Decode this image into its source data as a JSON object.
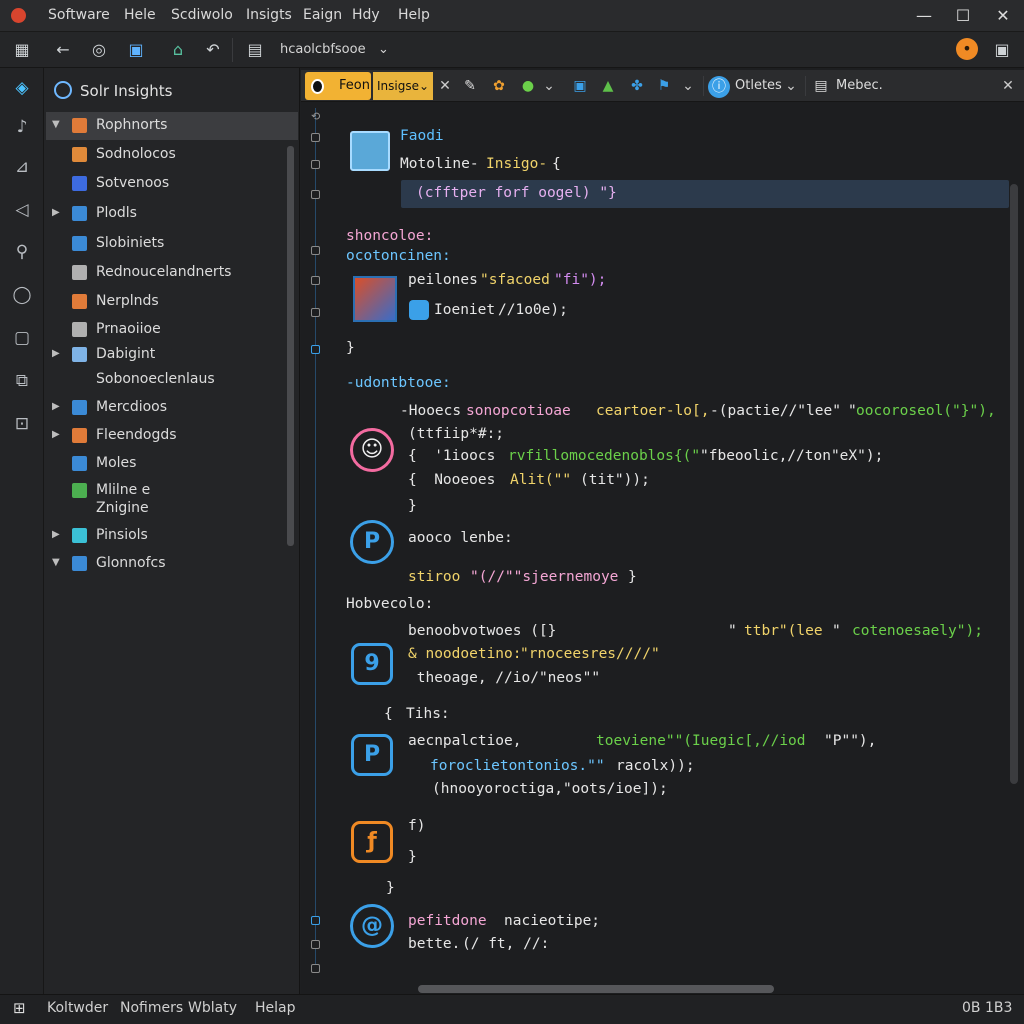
{
  "menu": [
    "Software",
    "Hele",
    "Scdiwolo",
    "Insigts",
    "Eaign",
    "Hdy",
    "Help"
  ],
  "window_controls": {
    "minimize": "—",
    "maximize": "☐",
    "close": "✕"
  },
  "toolbar": {
    "file_select": "hcaolcbfsooe"
  },
  "sidebar": {
    "title": "Solr Insights",
    "items": [
      {
        "label": "Rophnorts",
        "twisty": "▼",
        "color": "#e07b39",
        "selected": true
      },
      {
        "label": "Sodnolocos",
        "twisty": "",
        "color": "#e08a3a"
      },
      {
        "label": "Sotvenoos",
        "twisty": "",
        "color": "#3d6be0"
      },
      {
        "label": "Plodls",
        "twisty": "▶",
        "color": "#3b8ad6"
      },
      {
        "label": "Slobiniets",
        "twisty": "",
        "color": "#3b8ad6"
      },
      {
        "label": "Rednoucelandnerts",
        "twisty": "",
        "color": "#b0b0b0"
      },
      {
        "label": "Nerplnds",
        "twisty": "",
        "color": "#e07b39"
      },
      {
        "label": "Prnaoiioe",
        "twisty": "",
        "color": "#b0b0b0"
      },
      {
        "label": "Dabigint",
        "twisty": "▶",
        "color": "#7fb3e6"
      },
      {
        "label": "Sobonoeclenlaus",
        "twisty": "",
        "color": ""
      },
      {
        "label": "Mercdioos",
        "twisty": "▶",
        "color": "#3b8ad6"
      },
      {
        "label": "Fleendogds",
        "twisty": "▶",
        "color": "#e07b39"
      },
      {
        "label": "Moles",
        "twisty": "",
        "color": "#3b8ad6"
      },
      {
        "label": "Mlilne  e",
        "twisty": "",
        "color": "#4caf50"
      },
      {
        "label": "Znigine",
        "twisty": "",
        "color": ""
      },
      {
        "label": "Pinsiols",
        "twisty": "▶",
        "color": "#3bc1d6"
      },
      {
        "label": "Glonnofcs",
        "twisty": "▼",
        "color": "#3b8ad6"
      }
    ]
  },
  "editor_toolbar": {
    "tab_active": "Feon",
    "tab_insight": "Insigse",
    "dropdown_right": "Otletes",
    "file_label": "Mebec."
  },
  "code": {
    "l1": "Faodi",
    "l2a": "Motoline-",
    "l2b": "Insigo-",
    "l2c": "{",
    "l3": "(cfftper forf oogel) \"}",
    "l4": "shoncoloe:",
    "l5": "ocotoncinen:",
    "l6a": "peilones",
    "l6b": "\"sfacoed",
    "l6c": "\"fi\");",
    "l7a": "Ioeniet",
    "l7b": "//1o0e);",
    "l8": "}",
    "l9": "-udontbtooe:",
    "l10a": "-Hooecs",
    "l10b": "sonopcotioae",
    "l10c": "ceartoer-lo[,",
    "l10d": "-(pactie//\"lee\"",
    "l10e": "\"",
    "l10f": "oocoroseol(\"}\"),",
    "l11": "(ttfiip*#:;",
    "l12a": "{  '1ioocs",
    "l12b": "rvfillomocedenoblos{(\"",
    "l12c": "\"fbeoolic,//ton\"eX\");",
    "l13a": "{  Nooeoes",
    "l13b": "Alit(\"\"",
    "l13c": "(tit\"));",
    "l14": "}",
    "l15a": "aooco lenbe:",
    "l16a": "stiroo",
    "l16b": "\"(//\"\"sjeernemoye",
    "l16c": "}",
    "l17": "Hobvecolo:",
    "l18a": "benoobvotwoes ([}",
    "l18b": "\"",
    "l18c": "ttbr\"(lee",
    "l18d": "\"",
    "l18e": "cotenoesaely\");",
    "l19a": "& noodoetino:",
    "l19b": "\"rnoceesres////\"",
    "l20": " theoage, //io/\"neos\"\"",
    "l21a": "{",
    "l21b": "Tihs:",
    "l22a": "aecnpalctioe,",
    "l22b": "toeviene\"\"(Iuegic[,//iod",
    "l22c": "\"P\"\"),",
    "l23a": "foroclietontonios.\"\"",
    "l23b": "racolx));",
    "l24": "(hnooyoroctiga,\"oots/ioe]);",
    "l25": "f)",
    "l26": "}",
    "l27": "}",
    "l28a": "pefitdone",
    "l28b": "nacieotipe;",
    "l29a": "bette.",
    "l29b": "(/ ft, //:"
  },
  "statusbar": {
    "items": [
      "Koltwder",
      "Nofimers",
      "Wblaty",
      "Helap"
    ],
    "right": "0B 1B3"
  }
}
